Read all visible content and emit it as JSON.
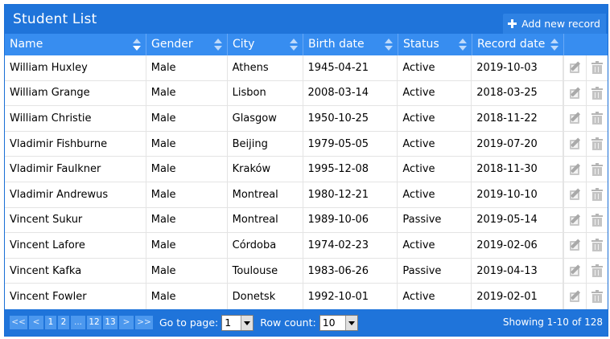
{
  "title": "Student List",
  "add_button": "Add new record",
  "columns": [
    {
      "label": "Name",
      "sort": "desc"
    },
    {
      "label": "Gender",
      "sort": "none"
    },
    {
      "label": "City",
      "sort": "none"
    },
    {
      "label": "Birth date",
      "sort": "none"
    },
    {
      "label": "Status",
      "sort": "none"
    },
    {
      "label": "Record date",
      "sort": "none"
    }
  ],
  "rows": [
    {
      "name": "William Huxley",
      "gender": "Male",
      "city": "Athens",
      "birth": "1945-04-21",
      "status": "Active",
      "record": "2019-10-03"
    },
    {
      "name": "William Grange",
      "gender": "Male",
      "city": "Lisbon",
      "birth": "2008-03-14",
      "status": "Active",
      "record": "2018-03-25"
    },
    {
      "name": "William Christie",
      "gender": "Male",
      "city": "Glasgow",
      "birth": "1950-10-25",
      "status": "Active",
      "record": "2018-11-22"
    },
    {
      "name": "Vladimir Fishburne",
      "gender": "Male",
      "city": "Beijing",
      "birth": "1979-05-05",
      "status": "Active",
      "record": "2019-07-20"
    },
    {
      "name": "Vladimir Faulkner",
      "gender": "Male",
      "city": "Kraków",
      "birth": "1995-12-08",
      "status": "Active",
      "record": "2018-11-30"
    },
    {
      "name": "Vladimir Andrewus",
      "gender": "Male",
      "city": "Montreal",
      "birth": "1980-12-21",
      "status": "Active",
      "record": "2019-10-10"
    },
    {
      "name": "Vincent Sukur",
      "gender": "Male",
      "city": "Montreal",
      "birth": "1989-10-06",
      "status": "Passive",
      "record": "2019-05-14"
    },
    {
      "name": "Vincent Lafore",
      "gender": "Male",
      "city": "Córdoba",
      "birth": "1974-02-23",
      "status": "Active",
      "record": "2019-02-06"
    },
    {
      "name": "Vincent Kafka",
      "gender": "Male",
      "city": "Toulouse",
      "birth": "1983-06-26",
      "status": "Passive",
      "record": "2019-04-13"
    },
    {
      "name": "Vincent Fowler",
      "gender": "Male",
      "city": "Donetsk",
      "birth": "1992-10-01",
      "status": "Active",
      "record": "2019-02-01"
    }
  ],
  "pager": {
    "first": "<<",
    "prev": "<",
    "pages": [
      "1",
      "2",
      "...",
      "12",
      "13"
    ],
    "next": ">",
    "last": ">>",
    "goto_label": "Go to page:",
    "goto_value": "1",
    "rowcount_label": "Row count:",
    "rowcount_value": "10",
    "showing": "Showing 1-10 of 128"
  },
  "icons": {
    "add": "plus-icon",
    "edit": "edit-icon",
    "delete": "trash-icon",
    "sort": "sort-arrows-icon"
  },
  "colors": {
    "header": "#1f74da",
    "column_header": "#378df0",
    "pager_button": "#4c98ee"
  }
}
